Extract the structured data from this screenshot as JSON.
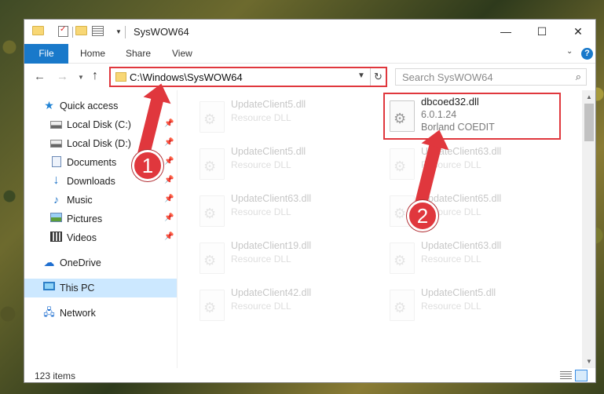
{
  "window": {
    "title": "SysWOW64",
    "minimize_glyph": "—",
    "maximize_glyph": "☐",
    "close_glyph": "✕"
  },
  "ribbon": {
    "tabs": [
      "File",
      "Home",
      "Share",
      "View"
    ],
    "help_glyph": "?"
  },
  "nav": {
    "address": "C:\\Windows\\SysWOW64",
    "search_placeholder": "Search SysWOW64"
  },
  "sidebar": {
    "items": [
      {
        "label": "Quick access",
        "icon": "quick-access-star-icon",
        "pinned": false
      },
      {
        "label": "Local Disk (C:)",
        "icon": "drive-icon",
        "pinned": true
      },
      {
        "label": "Local Disk (D:)",
        "icon": "drive-icon",
        "pinned": true
      },
      {
        "label": "Documents",
        "icon": "documents-icon",
        "pinned": true
      },
      {
        "label": "Downloads",
        "icon": "downloads-icon",
        "pinned": true
      },
      {
        "label": "Music",
        "icon": "music-icon",
        "pinned": true
      },
      {
        "label": "Pictures",
        "icon": "pictures-icon",
        "pinned": true
      },
      {
        "label": "Videos",
        "icon": "videos-icon",
        "pinned": true
      },
      {
        "label": "OneDrive",
        "icon": "onedrive-icon",
        "pinned": false
      },
      {
        "label": "This PC",
        "icon": "this-pc-icon",
        "pinned": false,
        "selected": true
      },
      {
        "label": "Network",
        "icon": "network-icon",
        "pinned": false
      }
    ]
  },
  "files": {
    "left_column": [
      {
        "name": "UpdateClient5.dll",
        "type": "Resource DLL"
      },
      {
        "name": "UpdateClient5.dll",
        "type": "Resource DLL"
      },
      {
        "name": "UpdateClient63.dll",
        "type": "Resource DLL"
      },
      {
        "name": "UpdateClient19.dll",
        "type": "Resource DLL"
      },
      {
        "name": "UpdateClient42.dll",
        "type": "Resource DLL"
      }
    ],
    "right_column": [
      {
        "name": "UpdateClient63.dll",
        "type": "Resource DLL"
      },
      {
        "name": "UpdateClient65.dll",
        "type": "Resource DLL"
      },
      {
        "name": "UpdateClient63.dll",
        "type": "Resource DLL"
      },
      {
        "name": "UpdateClient5.dll",
        "type": "Resource DLL"
      }
    ],
    "highlighted": {
      "name": "dbcoed32.dll",
      "version": "6.0.1.24",
      "description": "Borland COEDIT"
    }
  },
  "status": {
    "item_count": "123 items"
  },
  "annotations": {
    "step1": "1",
    "step2": "2"
  },
  "colors": {
    "accent": "#1979ca",
    "highlight_red": "#e0373d",
    "selected_bg": "#cce8ff"
  }
}
